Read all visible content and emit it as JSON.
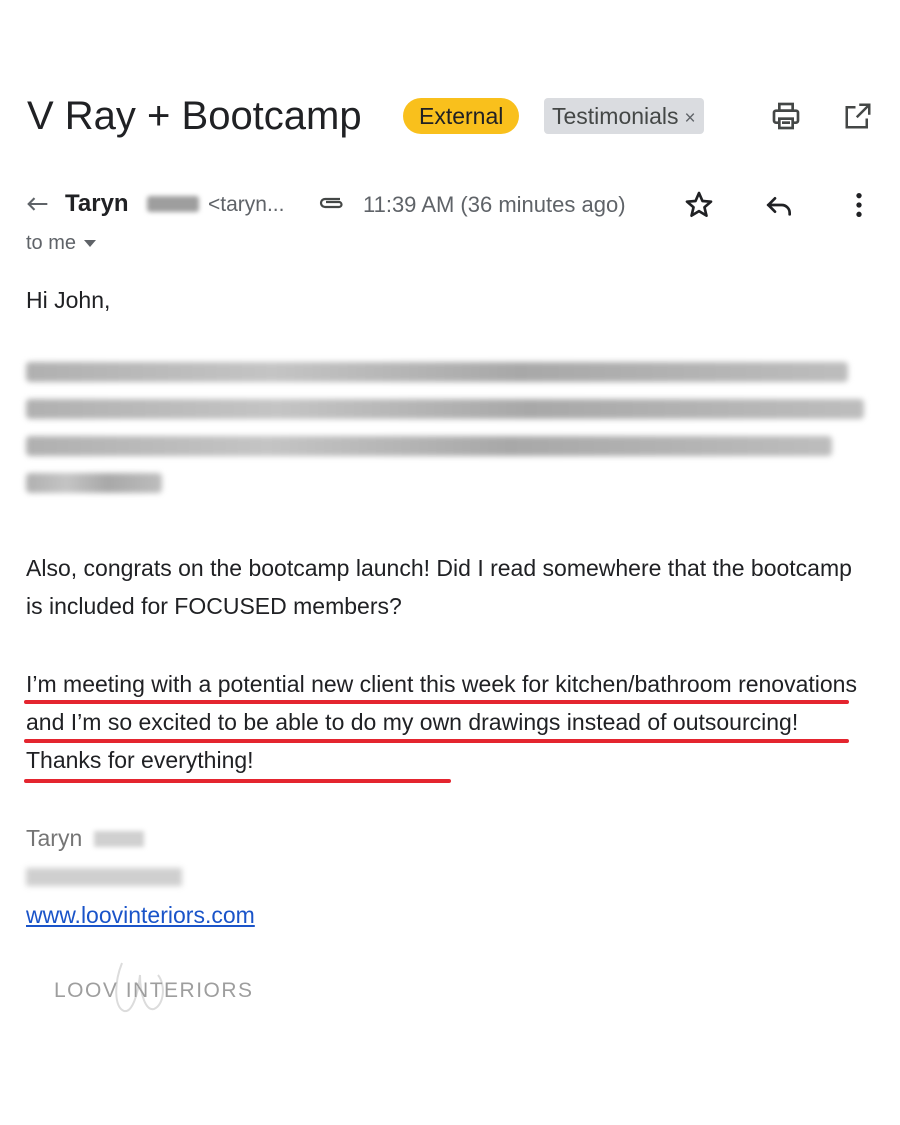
{
  "header": {
    "subject": "V Ray + Bootcamp",
    "chip_external": "External",
    "chip_label": "Testimonials",
    "chip_label_close": "×",
    "icons": [
      "print-icon",
      "open-in-new-window-icon"
    ]
  },
  "sender": {
    "name": "Taryn",
    "email_truncated": "<taryn...",
    "timestamp": "11:39 AM (36 minutes ago)",
    "to": "to me",
    "icons": [
      "reply-arrow-icon",
      "attachment-icon",
      "star-icon",
      "reply-icon",
      "more-vert-icon"
    ]
  },
  "body": {
    "greeting": "Hi John,",
    "para2": "Also, congrats on the bootcamp launch! Did I read somewhere that the bootcamp is included for FOCUSED members?",
    "para3": "I’m meeting with a potential new client this week for kitchen/bathroom renovations and I’m so excited to be able to do my own drawings instead of outsourcing! Thanks for everything!"
  },
  "signature": {
    "name": "Taryn",
    "website": "www.loovinteriors.com",
    "logo_text": "LOOV INTERIORS"
  },
  "colors": {
    "external_chip": "#f9c01c",
    "label_chip": "#dadce0",
    "highlight_underline": "#e4252f",
    "link": "#1a54c9"
  }
}
